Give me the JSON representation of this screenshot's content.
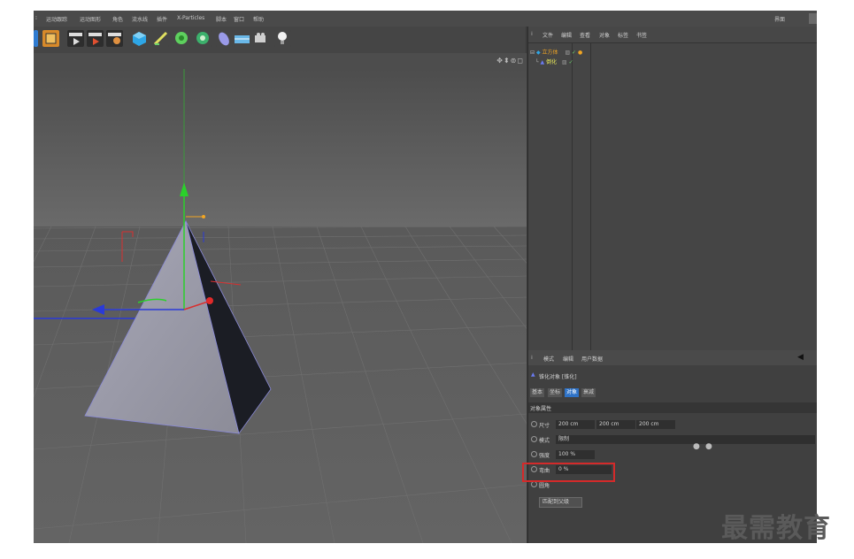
{
  "menubar": {
    "items": [
      "运动跟踪",
      "运动图形",
      "角色",
      "流水线",
      "插件",
      "X-Particles",
      "脚本",
      "窗口",
      "帮助"
    ],
    "layout_label": "界面"
  },
  "object_manager": {
    "menu": [
      "文件",
      "编辑",
      "查看",
      "对象",
      "标签",
      "书签"
    ],
    "objects": [
      {
        "name": "立方体",
        "color": "#f2a623"
      },
      {
        "name": "倒化",
        "color": "#e8e85a"
      }
    ]
  },
  "attributes": {
    "menu": [
      "模式",
      "编辑",
      "用户数据"
    ],
    "object_title": "锥化对象 [锥化]",
    "tabs": [
      "基本",
      "坐标",
      "对象",
      "衰减"
    ],
    "active_tab": "对象",
    "section": "对象属性",
    "size_label": "尺寸",
    "size_x": "200 cm",
    "size_y": "200 cm",
    "size_z": "200 cm",
    "mode_label": "模式",
    "mode_value": "限制",
    "strength_label": "强度",
    "strength_value": "100 %",
    "curve_label": "弯曲",
    "curve_value": "0 %",
    "fillet_label": "圆角",
    "fillet_value": "",
    "match_button": "匹配到父级"
  },
  "colors": {
    "highlight": "#d42a2a",
    "active_tab": "#2e72c6"
  },
  "watermark": "最需教育"
}
